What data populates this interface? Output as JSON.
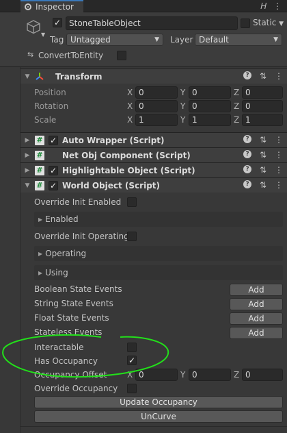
{
  "tab": {
    "label": "Inspector",
    "lock_icon": "lock-icon",
    "menu_icon": "kebab-menu-icon"
  },
  "header": {
    "object_name": "StoneTableObject",
    "static_label": "Static",
    "tag_label": "Tag",
    "tag_value": "Untagged",
    "layer_label": "Layer",
    "layer_value": "Default",
    "convert_label": "ConvertToEntity"
  },
  "transform": {
    "title": "Transform",
    "rows": [
      {
        "label": "Position",
        "x": "0",
        "y": "0",
        "z": "0"
      },
      {
        "label": "Rotation",
        "x": "0",
        "y": "0",
        "z": "0"
      },
      {
        "label": "Scale",
        "x": "1",
        "y": "1",
        "z": "1"
      }
    ],
    "axis_x": "X",
    "axis_y": "Y",
    "axis_z": "Z"
  },
  "components": [
    {
      "title": "Auto Wrapper (Script)"
    },
    {
      "title": "Net Obj Component (Script)"
    },
    {
      "title": "Highlightable Object (Script)"
    },
    {
      "title": "World Object (Script)"
    }
  ],
  "world_object": {
    "override_init_enabled": "Override Init Enabled",
    "enabled": "Enabled",
    "override_init_operating": "Override Init Operating",
    "operating": "Operating",
    "using": "Using",
    "boolean_state_events": "Boolean State Events",
    "string_state_events": "String State Events",
    "float_state_events": "Float State Events",
    "stateless_events": "Stateless Events",
    "add_label": "Add",
    "interactable": "Interactable",
    "has_occupancy": "Has Occupancy",
    "occupancy_offset": "Occupancy Offset",
    "offset_x": "0",
    "offset_y": "0",
    "offset_z": "0",
    "override_occupancy": "Override Occupancy",
    "update_occupancy": "Update Occupancy",
    "uncurve": "UnCurve"
  },
  "annotation_color": "#22e01a"
}
